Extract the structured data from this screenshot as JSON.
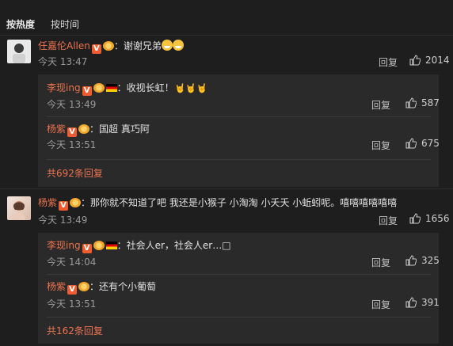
{
  "sort": {
    "by_hot": "按热度",
    "by_time": "按时间"
  },
  "comments": [
    {
      "user": "任嘉伦Allen",
      "text": "：谢谢兄弟",
      "time": "今天 13:47",
      "reply_label": "回复",
      "likes": "2014",
      "replies": [
        {
          "user": "李现ing",
          "text": "：收视长虹！",
          "time": "今天 13:49",
          "reply_label": "回复",
          "likes": "587"
        },
        {
          "user": "杨紫",
          "text": "：国超 真巧阿",
          "time": "今天 13:51",
          "reply_label": "回复",
          "likes": "675"
        }
      ],
      "more_text": "共692条回复"
    },
    {
      "user": "杨紫",
      "text": "：那你就不知道了吧 我还是小猴子 小淘淘 小夭夭 小蚯蚓呢。嘻嘻嘻嘻嘻嘻",
      "time": "今天 13:49",
      "reply_label": "回复",
      "likes": "1656",
      "replies": [
        {
          "user": "李现ing",
          "text": "：社会人er，社会人er…□",
          "time": "今天 14:04",
          "reply_label": "回复",
          "likes": "325"
        },
        {
          "user": "杨紫",
          "text": "：还有个小葡萄",
          "time": "今天 13:51",
          "reply_label": "回复",
          "likes": "391"
        }
      ],
      "more_text": "共162条回复"
    }
  ],
  "colors": {
    "username": "#eb7350",
    "background": "#1e1e1e",
    "reply_box": "#2a2a2a"
  },
  "icons": {
    "verified": "V",
    "like": "thumb-up-icon",
    "flag": "germany-flag-icon",
    "vip": "vip-crown-icon"
  }
}
